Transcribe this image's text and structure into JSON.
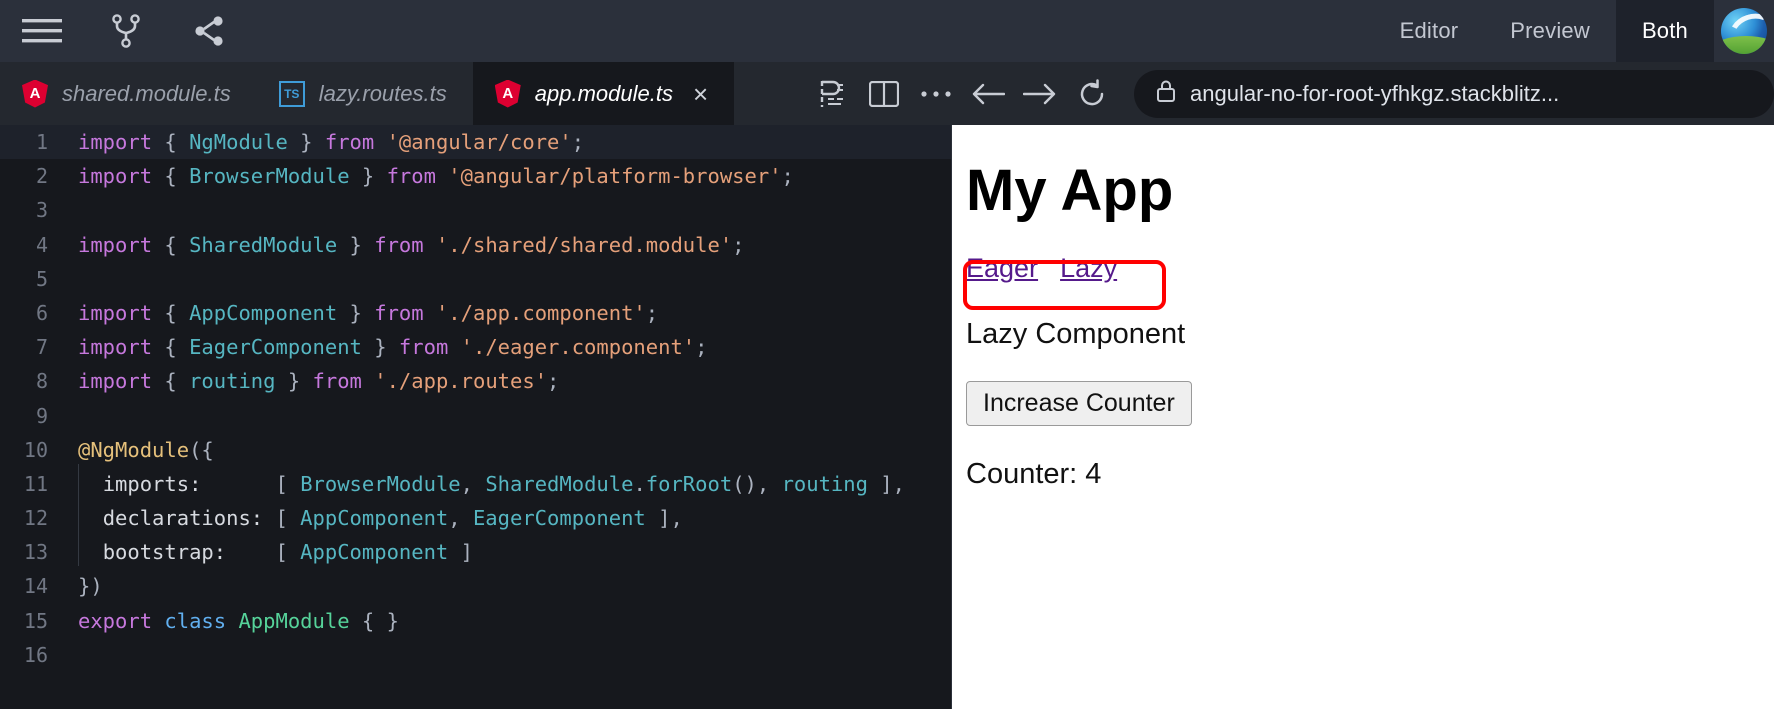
{
  "topbar": {
    "icons": [
      {
        "name": "hamburger-menu-icon",
        "label": "Menu"
      },
      {
        "name": "fork-icon",
        "label": "Fork"
      },
      {
        "name": "share-icon",
        "label": "Share"
      }
    ],
    "view_tabs": [
      {
        "label": "Editor",
        "active": false
      },
      {
        "label": "Preview",
        "active": false
      },
      {
        "label": "Both",
        "active": true
      }
    ],
    "avatar_label": "User avatar"
  },
  "tabs": [
    {
      "label": "shared.module.ts",
      "icon": "angular-icon",
      "icon_text": "A",
      "active": false,
      "closable": false
    },
    {
      "label": "lazy.routes.ts",
      "icon": "typescript-icon",
      "icon_text": "TS",
      "active": false,
      "closable": false
    },
    {
      "label": "app.module.ts",
      "icon": "angular-icon",
      "icon_text": "A",
      "active": true,
      "closable": true,
      "close_label": "×"
    }
  ],
  "chrome": {
    "buttons": [
      {
        "name": "prettier-icon",
        "label": "Format"
      },
      {
        "name": "split-panel-icon",
        "label": "Split"
      },
      {
        "name": "more-options-icon",
        "label": "More"
      },
      {
        "name": "back-arrow-icon",
        "label": "Back"
      },
      {
        "name": "forward-arrow-icon",
        "label": "Forward"
      },
      {
        "name": "reload-icon",
        "label": "Reload"
      }
    ],
    "url": "angular-no-for-root-yfhkgz.stackblitz...",
    "lock_label": "Secure"
  },
  "editor": {
    "filename": "app.module.ts",
    "current_line": 1,
    "lines": [
      {
        "n": "1",
        "current": true,
        "indent": false,
        "tokens": [
          {
            "t": "import ",
            "c": "k"
          },
          {
            "t": "{ ",
            "c": "p"
          },
          {
            "t": "NgModule",
            "c": "t"
          },
          {
            "t": " } ",
            "c": "p"
          },
          {
            "t": "from ",
            "c": "k"
          },
          {
            "t": "'@angular/core'",
            "c": "s"
          },
          {
            "t": ";",
            "c": "p"
          }
        ]
      },
      {
        "n": "2",
        "current": false,
        "indent": false,
        "tokens": [
          {
            "t": "import ",
            "c": "k"
          },
          {
            "t": "{ ",
            "c": "p"
          },
          {
            "t": "BrowserModule",
            "c": "t"
          },
          {
            "t": " } ",
            "c": "p"
          },
          {
            "t": "from ",
            "c": "k"
          },
          {
            "t": "'@angular/platform-browser'",
            "c": "s"
          },
          {
            "t": ";",
            "c": "p"
          }
        ]
      },
      {
        "n": "3",
        "current": false,
        "indent": false,
        "tokens": []
      },
      {
        "n": "4",
        "current": false,
        "indent": false,
        "tokens": [
          {
            "t": "import ",
            "c": "k"
          },
          {
            "t": "{ ",
            "c": "p"
          },
          {
            "t": "SharedModule",
            "c": "t"
          },
          {
            "t": " } ",
            "c": "p"
          },
          {
            "t": "from ",
            "c": "k"
          },
          {
            "t": "'./shared/shared.module'",
            "c": "s"
          },
          {
            "t": ";",
            "c": "p"
          }
        ]
      },
      {
        "n": "5",
        "current": false,
        "indent": false,
        "tokens": []
      },
      {
        "n": "6",
        "current": false,
        "indent": false,
        "tokens": [
          {
            "t": "import ",
            "c": "k"
          },
          {
            "t": "{ ",
            "c": "p"
          },
          {
            "t": "AppComponent",
            "c": "t"
          },
          {
            "t": " } ",
            "c": "p"
          },
          {
            "t": "from ",
            "c": "k"
          },
          {
            "t": "'./app.component'",
            "c": "s"
          },
          {
            "t": ";",
            "c": "p"
          }
        ]
      },
      {
        "n": "7",
        "current": false,
        "indent": false,
        "tokens": [
          {
            "t": "import ",
            "c": "k"
          },
          {
            "t": "{ ",
            "c": "p"
          },
          {
            "t": "EagerComponent",
            "c": "t"
          },
          {
            "t": " } ",
            "c": "p"
          },
          {
            "t": "from ",
            "c": "k"
          },
          {
            "t": "'./eager.component'",
            "c": "s"
          },
          {
            "t": ";",
            "c": "p"
          }
        ]
      },
      {
        "n": "8",
        "current": false,
        "indent": false,
        "tokens": [
          {
            "t": "import ",
            "c": "k"
          },
          {
            "t": "{ ",
            "c": "p"
          },
          {
            "t": "routing",
            "c": "t"
          },
          {
            "t": " } ",
            "c": "p"
          },
          {
            "t": "from ",
            "c": "k"
          },
          {
            "t": "'./app.routes'",
            "c": "s"
          },
          {
            "t": ";",
            "c": "p"
          }
        ]
      },
      {
        "n": "9",
        "current": false,
        "indent": false,
        "tokens": []
      },
      {
        "n": "10",
        "current": false,
        "indent": false,
        "tokens": [
          {
            "t": "@NgModule",
            "c": "d"
          },
          {
            "t": "({",
            "c": "p"
          }
        ]
      },
      {
        "n": "11",
        "current": false,
        "indent": true,
        "tokens": [
          {
            "t": "  ",
            "c": "p"
          },
          {
            "t": "imports:",
            "c": "pr"
          },
          {
            "t": "      ",
            "c": "p"
          },
          {
            "t": "[ ",
            "c": "p"
          },
          {
            "t": "BrowserModule",
            "c": "t"
          },
          {
            "t": ", ",
            "c": "p"
          },
          {
            "t": "SharedModule",
            "c": "t"
          },
          {
            "t": ".",
            "c": "p"
          },
          {
            "t": "forRoot",
            "c": "t"
          },
          {
            "t": "(), ",
            "c": "p"
          },
          {
            "t": "routing",
            "c": "t"
          },
          {
            "t": " ],",
            "c": "p"
          }
        ]
      },
      {
        "n": "12",
        "current": false,
        "indent": true,
        "tokens": [
          {
            "t": "  ",
            "c": "p"
          },
          {
            "t": "declarations:",
            "c": "pr"
          },
          {
            "t": " ",
            "c": "p"
          },
          {
            "t": "[ ",
            "c": "p"
          },
          {
            "t": "AppComponent",
            "c": "t"
          },
          {
            "t": ", ",
            "c": "p"
          },
          {
            "t": "EagerComponent",
            "c": "t"
          },
          {
            "t": " ],",
            "c": "p"
          }
        ]
      },
      {
        "n": "13",
        "current": false,
        "indent": true,
        "tokens": [
          {
            "t": "  ",
            "c": "p"
          },
          {
            "t": "bootstrap:",
            "c": "pr"
          },
          {
            "t": "    ",
            "c": "p"
          },
          {
            "t": "[ ",
            "c": "p"
          },
          {
            "t": "AppComponent",
            "c": "t"
          },
          {
            "t": " ]",
            "c": "p"
          }
        ]
      },
      {
        "n": "14",
        "current": false,
        "indent": false,
        "tokens": [
          {
            "t": "})",
            "c": "p"
          }
        ]
      },
      {
        "n": "15",
        "current": false,
        "indent": false,
        "tokens": [
          {
            "t": "export ",
            "c": "k"
          },
          {
            "t": "class ",
            "c": "kb"
          },
          {
            "t": "AppModule",
            "c": "g"
          },
          {
            "t": " { }",
            "c": "p"
          }
        ]
      },
      {
        "n": "16",
        "current": false,
        "indent": false,
        "tokens": []
      }
    ]
  },
  "preview": {
    "heading": "My App",
    "links": [
      {
        "label": "Eager"
      },
      {
        "label": "Lazy"
      }
    ],
    "component_text": "Lazy Component",
    "button_label": "Increase Counter",
    "counter_text": "Counter: 4"
  },
  "annotation": {
    "color": "#ff0000",
    "target": "nav-links-highlight"
  },
  "colors": {
    "topbar_bg": "#2b303b",
    "tabbar_bg": "#24282f",
    "editor_bg": "#16181d",
    "preview_bg": "#ffffff",
    "link": "#551a8b",
    "angular_red": "#dd0031",
    "typescript_blue": "#3f9cd8",
    "annotation_red": "#ff0000"
  }
}
